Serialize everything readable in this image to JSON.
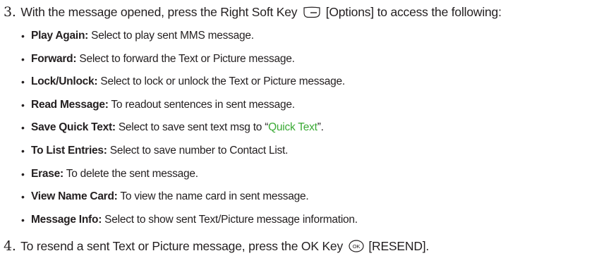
{
  "step3": {
    "number": "3.",
    "text_before": "With the message opened, press the Right Soft Key",
    "key_icon": "right-soft-key-icon",
    "text_after": "[Options] to access the following:"
  },
  "options": [
    {
      "term": "Play Again:",
      "desc": "Select to play sent MMS message."
    },
    {
      "term": "Forward:",
      "desc": "Select to forward the Text or Picture message."
    },
    {
      "term": "Lock/Unlock:",
      "desc": "Select to lock or unlock the Text or Picture message."
    },
    {
      "term": "Read Message:",
      "desc": "To readout sentences in sent message."
    },
    {
      "term": "Save Quick Text:",
      "desc": "Select to save sent text msg to “",
      "link": "Quick Text",
      "desc_end": "”."
    },
    {
      "term": "To List Entries:",
      "desc": "Select to save number to Contact List."
    },
    {
      "term": "Erase:",
      "desc": "To delete the sent message."
    },
    {
      "term": "View Name Card:",
      "desc": "To view the name card in sent message."
    },
    {
      "term": "Message Info:",
      "desc": "Select to show sent Text/Picture message information."
    }
  ],
  "step4": {
    "number": "4.",
    "text_before": "To resend a sent Text or Picture message, press the OK Key",
    "key_icon": "ok-key-icon",
    "key_label": "OK",
    "text_after": "[RESEND]."
  },
  "colors": {
    "text": "#231f20",
    "link": "#3aaa35"
  }
}
